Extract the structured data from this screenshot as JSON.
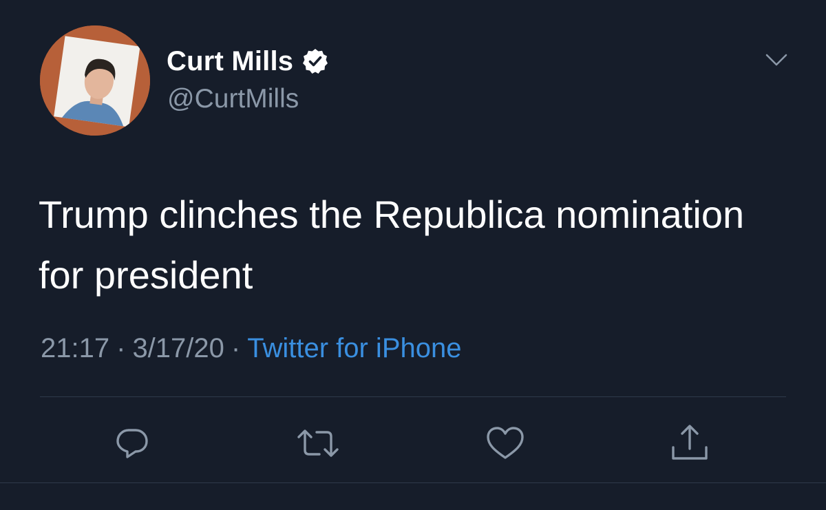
{
  "tweet": {
    "display_name": "Curt Mills",
    "handle": "@CurtMills",
    "text": "Trump clinches the Republica nomination for president",
    "time": "21:17",
    "date": "3/17/20",
    "separator": "·",
    "source": "Twitter for iPhone"
  },
  "icons": {
    "avatar": "profile-photo",
    "verified": "verified-badge-icon",
    "caret": "chevron-down-icon",
    "reply": "reply-icon",
    "retweet": "retweet-icon",
    "like": "heart-icon",
    "share": "share-icon"
  },
  "colors": {
    "background": "#161d2a",
    "primary_text": "#ffffff",
    "secondary_text": "#8b98a8",
    "link": "#3a8fe0",
    "divider": "#2f3a4a"
  }
}
